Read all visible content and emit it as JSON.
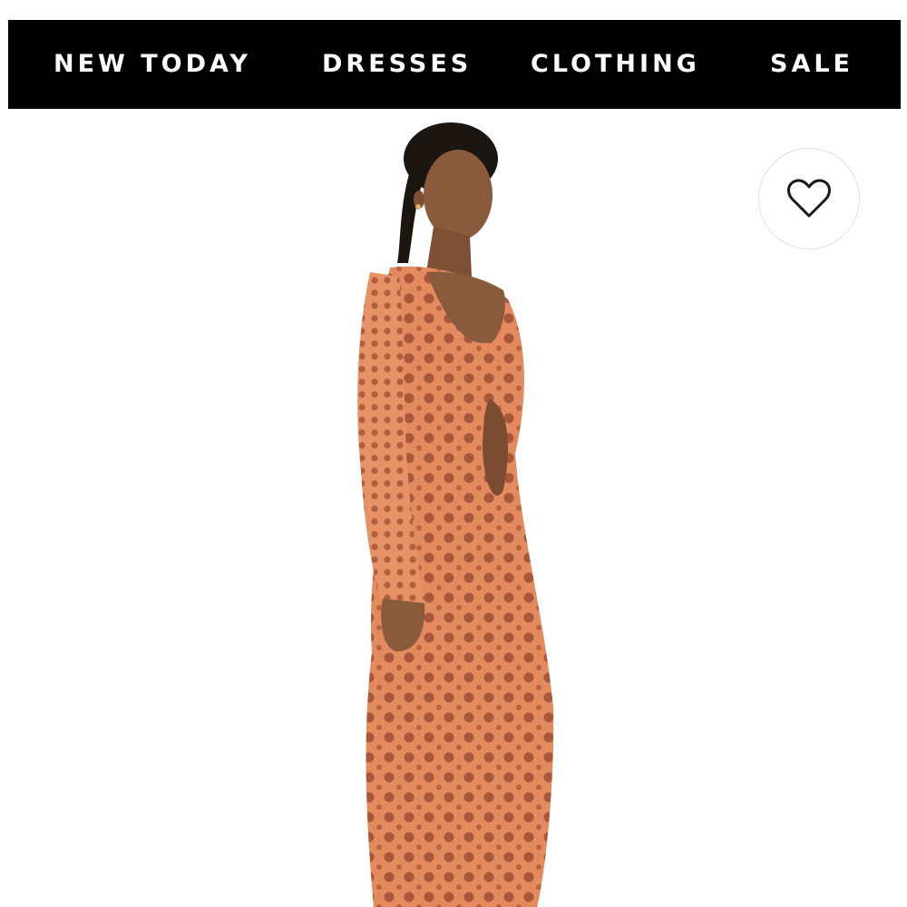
{
  "nav": {
    "items": [
      {
        "label": "NEW TODAY"
      },
      {
        "label": "DRESSES"
      },
      {
        "label": "CLOTHING"
      },
      {
        "label": "SALE"
      }
    ],
    "background": "#000000",
    "text_color": "#ffffff"
  },
  "product": {
    "garment_color": "#e8895f",
    "skin_color": "#8a5a3c",
    "hair_color": "#1c1612"
  },
  "wishlist": {
    "icon": "heart-outline-icon"
  }
}
